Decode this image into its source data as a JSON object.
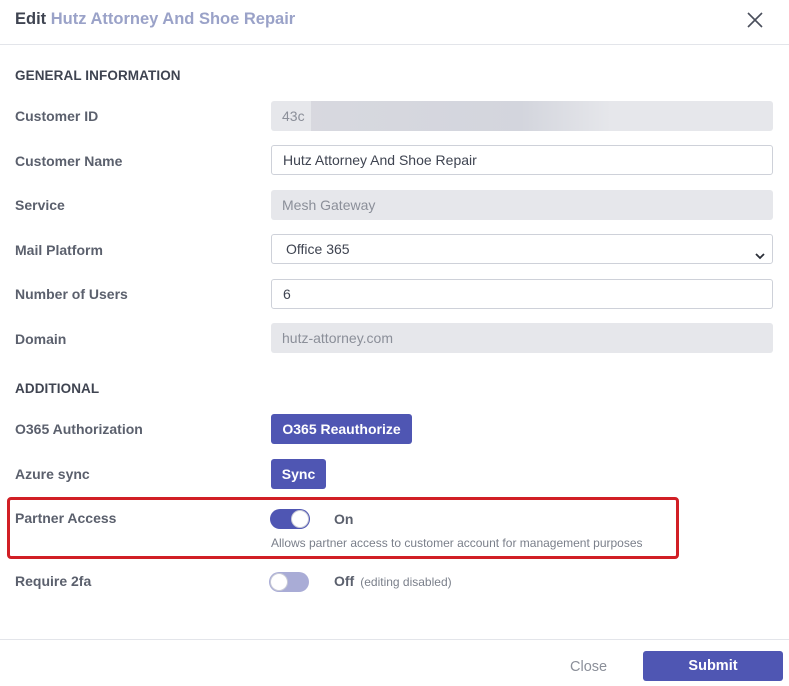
{
  "header": {
    "title_prefix": "Edit",
    "customer_name": "Hutz Attorney And Shoe Repair",
    "close_icon": "close-icon"
  },
  "general": {
    "section_title": "GENERAL INFORMATION",
    "customer_id": {
      "label": "Customer ID",
      "value": "43c"
    },
    "customer_name": {
      "label": "Customer Name",
      "value": "Hutz Attorney And Shoe Repair"
    },
    "service": {
      "label": "Service",
      "value": "Mesh Gateway"
    },
    "mail_platform": {
      "label": "Mail Platform",
      "value": "Office 365"
    },
    "number_of_users": {
      "label": "Number of Users",
      "value": "6"
    },
    "domain": {
      "label": "Domain",
      "value": "hutz-attorney.com"
    }
  },
  "additional": {
    "section_title": "ADDITIONAL",
    "o365_authorization": {
      "label": "O365 Authorization",
      "button": "O365 Reauthorize"
    },
    "azure_sync": {
      "label": "Azure sync",
      "button": "Sync"
    },
    "partner_access": {
      "label": "Partner Access",
      "state": "On",
      "enabled": true,
      "help": "Allows partner access to customer account for management purposes"
    },
    "require_2fa": {
      "label": "Require 2fa",
      "state": "Off",
      "enabled": false,
      "note": "(editing disabled)"
    }
  },
  "footer": {
    "close_label": "Close",
    "submit_label": "Submit"
  },
  "colors": {
    "primary": "#4f56b3",
    "highlight": "#d11f25",
    "customer_name_accent": "#9aa2c8"
  }
}
